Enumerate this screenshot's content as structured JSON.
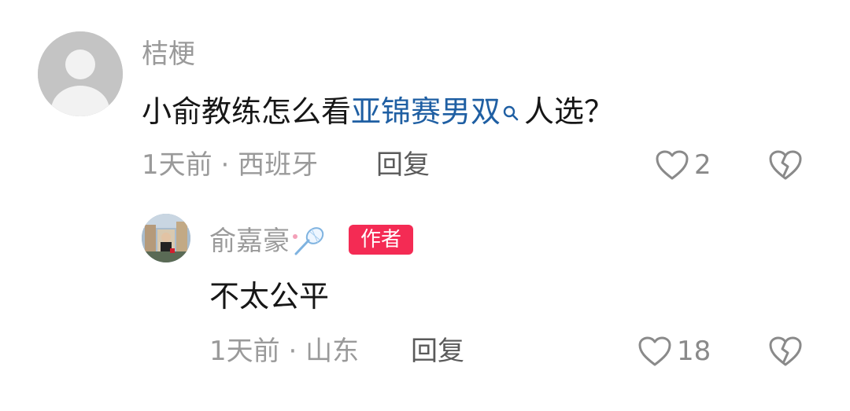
{
  "comments": [
    {
      "username": "桔梗",
      "text_before": "小俞教练怎么看",
      "search_link": "亚锦赛男双",
      "text_after": "人选？",
      "time": "1天前",
      "location": "西班牙",
      "reply_label": "回复",
      "likes": "2"
    }
  ],
  "replies": [
    {
      "username": "俞嘉豪",
      "badge": "作者",
      "text": "不太公平",
      "time": "1天前",
      "location": "山东",
      "reply_label": "回复",
      "likes": "18"
    }
  ],
  "meta_separator": "·",
  "icons": {
    "search": "search-icon",
    "like": "heart-outline-icon",
    "dislike": "broken-heart-icon",
    "badminton": "badminton-racket-icon"
  },
  "colors": {
    "link": "#1f5fa3",
    "author_badge": "#f42b54",
    "muted_text": "#9a9a9a"
  }
}
